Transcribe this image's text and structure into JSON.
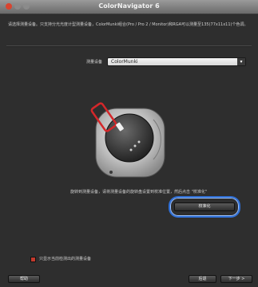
{
  "window": {
    "title": "ColorNavigator 6"
  },
  "description": "请选择测量设备。只支持分光光度计型测量设备，ColorMunki组合(Pro / Pro 2 / Monitor)和RGA可以测量至135(77x11x11)个色调。",
  "device": {
    "label": "测量设备",
    "value": "ColorMunki"
  },
  "instruction": "旋转到测量设备，请将测量设备的旋转盘设置到校准位置，然后点击 \"校准化\"",
  "buttons": {
    "calibrate": "校准化",
    "help": "帮助",
    "back": "后退",
    "next": "下一步 >"
  },
  "checkbox": {
    "label": "只显示当前检测出的测量设备",
    "checked": true
  }
}
